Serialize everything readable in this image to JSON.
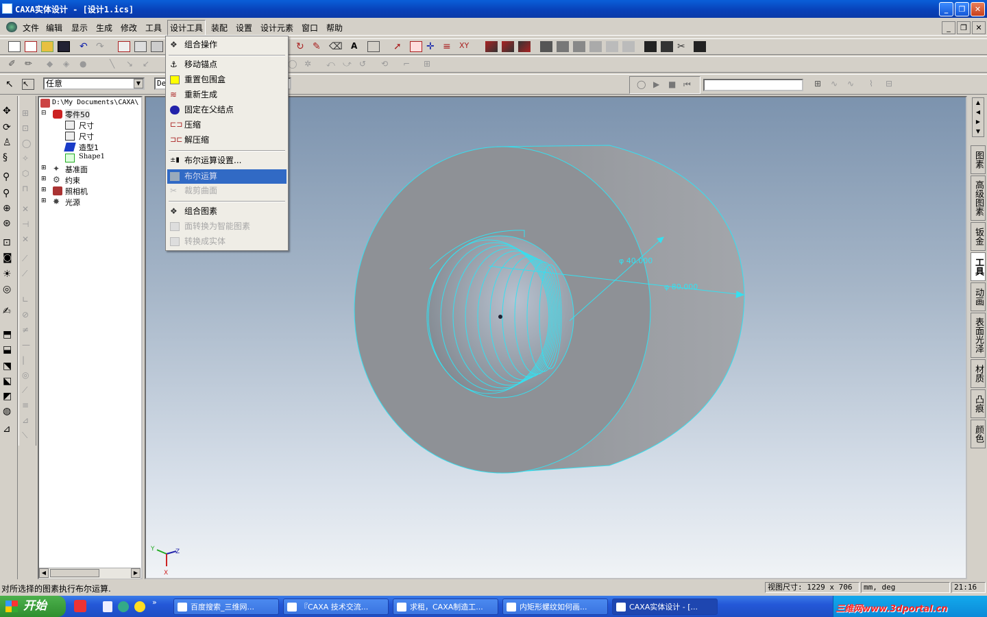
{
  "window": {
    "title": "CAXA实体设计 - [设计1.ics]"
  },
  "menu": [
    "文件",
    "编辑",
    "显示",
    "生成",
    "修改",
    "工具",
    "设计工具",
    "装配",
    "设置",
    "设计元素",
    "窗口",
    "帮助"
  ],
  "toolbar": {
    "filter_combo": "任意",
    "second_combo": "De"
  },
  "dropdown": {
    "items": [
      {
        "label": "组合操作",
        "disabled": false
      },
      {
        "label": "移动锚点",
        "disabled": false
      },
      {
        "label": "重置包围盒",
        "disabled": false
      },
      {
        "label": "重新生成",
        "disabled": false
      },
      {
        "label": "固定在父结点",
        "disabled": false
      },
      {
        "label": "压缩",
        "disabled": false
      },
      {
        "label": "解压缩",
        "disabled": false
      },
      {
        "label": "布尔运算设置...",
        "disabled": false
      },
      {
        "label": "布尔运算",
        "disabled": true,
        "selected": true
      },
      {
        "label": "裁剪曲面",
        "disabled": true
      },
      {
        "label": "组合图素",
        "disabled": false
      },
      {
        "label": "面转换为智能图素",
        "disabled": true
      },
      {
        "label": "转换成实体",
        "disabled": true
      }
    ]
  },
  "tree": {
    "root": "D:\\My Documents\\CAXA\\",
    "part": "零件50",
    "children": [
      "尺寸",
      "尺寸",
      "造型1",
      "Shape1"
    ],
    "groups": [
      "基准面",
      "约束",
      "照相机",
      "光源"
    ]
  },
  "viewport": {
    "dim_small": "φ 40.000",
    "dim_large": "φ 80.000",
    "axis_y": "Y",
    "axis_z": "Z",
    "axis_x": "X"
  },
  "right_tabs": [
    "图素",
    "高级图素",
    "钣金",
    "工具",
    "动画",
    "表面光泽",
    "材质",
    "凸痕",
    "颜色"
  ],
  "status": {
    "message": "对所选择的图素执行布尔运算.",
    "view_size": "视图尺寸: 1229 x  706",
    "units": "mm, deg",
    "time": "21:16"
  },
  "taskbar": {
    "start": "开始",
    "tasks": [
      "百度搜索_三维网...",
      "『CAXA 技术交流...",
      "求租，CAXA制造工...",
      "内矩形螺纹如何画...",
      "CAXA实体设计 - [..."
    ],
    "watermark": "三维网www.3dportal.cn"
  },
  "colors": {
    "selection": "#316ac5",
    "edge": "#35e0f0",
    "titlebar": "#0a5fd8"
  }
}
